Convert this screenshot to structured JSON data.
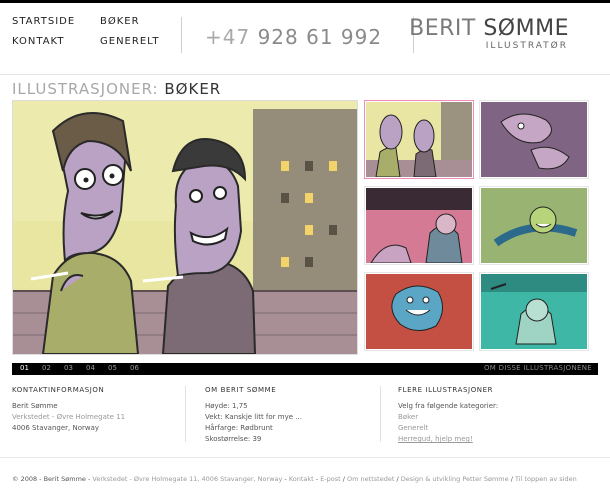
{
  "nav": {
    "items": [
      {
        "label": "STARTSIDE"
      },
      {
        "label": "BØKER"
      },
      {
        "label": "KONTAKT"
      },
      {
        "label": "GENERELT"
      }
    ]
  },
  "phone": {
    "prefix": "+47",
    "number": "928 61 992"
  },
  "logo": {
    "first": "BERIT",
    "last": "SØMME",
    "subtitle": "ILLUSTRATØR"
  },
  "title": {
    "prefix": "ILLUSTRASJONER:",
    "section": "BØKER"
  },
  "pager": {
    "pages": [
      "01",
      "02",
      "03",
      "04",
      "05",
      "06"
    ],
    "active_index": 0,
    "about_link": "OM DISSE ILLUSTRASJONENE"
  },
  "contact": {
    "heading": "KONTAKTINFORMASJON",
    "name": "Berit Sømme",
    "studio": "Verkstedet - Øvre Holmegate 11",
    "city": "4006 Stavanger, Norway"
  },
  "about": {
    "heading": "OM BERIT SØMME",
    "lines": [
      "Høyde: 1,75",
      "Vekt: Kanskje litt for mye ...",
      "Hårfarge: Rødbrunt",
      "Skostørrelse: 39"
    ]
  },
  "more": {
    "heading": "FLERE ILLUSTRASJONER",
    "intro": "Velg fra følgende kategorier:",
    "links": [
      "Bøker",
      "Generelt",
      "Herregud, hjelp meg!"
    ]
  },
  "footer": {
    "copyright": "© 2008 - Berit Sømme - ",
    "address": "Verkstedet - Øvre Holmegate 11, 4006 Stavanger, Norway",
    "sep": " - ",
    "kontakt": "Kontakt",
    "epost": "E-post",
    "slash": " / ",
    "om": "Om nettstedet",
    "design": "Design & utvikling Petter Sømme",
    "top": "Til toppen av siden"
  },
  "colors": {
    "accent_pink": "#f08ab8",
    "pager_bg": "#000000",
    "muted_text": "#999999"
  }
}
